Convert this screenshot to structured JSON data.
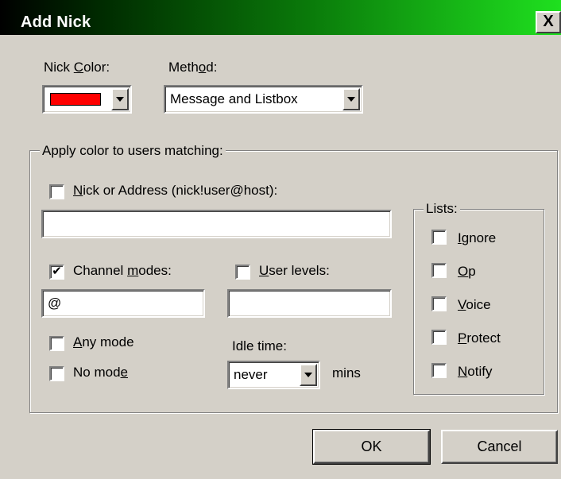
{
  "dialog": {
    "title": "Add Nick",
    "close_glyph": "X"
  },
  "nick_color": {
    "label_pre": "Nick ",
    "label_key": "C",
    "label_post": "olor:",
    "value_color": "#ff0000"
  },
  "method": {
    "label_pre": "Meth",
    "label_key": "o",
    "label_post": "d:",
    "value": "Message and Listbox"
  },
  "match_group": {
    "label": "Apply color to users matching:",
    "nick_address": {
      "checked": false,
      "label_key": "N",
      "label_rest": "ick or Address (nick!user@host):",
      "value": ""
    },
    "channel_modes": {
      "checked": true,
      "check_glyph": "✔",
      "label_pre": "Channel ",
      "label_key": "m",
      "label_post": "odes:",
      "value": "@"
    },
    "user_levels": {
      "checked": false,
      "label_key": "U",
      "label_rest": "ser levels:",
      "value": ""
    },
    "any_mode": {
      "checked": false,
      "label_key": "A",
      "label_rest": "ny mode"
    },
    "no_mode": {
      "checked": false,
      "label_pre": "No mod",
      "label_key": "e",
      "label_post": ""
    },
    "idle_time": {
      "label": "Idle time:",
      "value": "never",
      "unit": "mins"
    }
  },
  "lists": {
    "label": "Lists:",
    "items": [
      {
        "key": "I",
        "rest": "gnore",
        "checked": false
      },
      {
        "key": "O",
        "rest": "p",
        "checked": false
      },
      {
        "key": "V",
        "rest": "oice",
        "checked": false
      },
      {
        "key": "P",
        "rest": "rotect",
        "checked": false
      },
      {
        "key": "N",
        "rest": "otify",
        "checked": false
      }
    ]
  },
  "buttons": {
    "ok": "OK",
    "cancel": "Cancel"
  }
}
